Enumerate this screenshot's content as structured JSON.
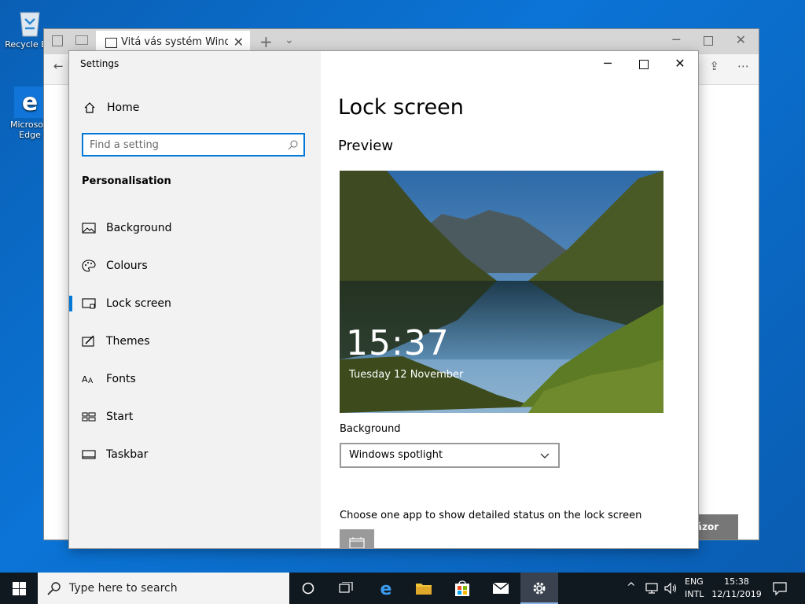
{
  "desktop": {
    "icons": [
      {
        "label": "Recycle Bin"
      },
      {
        "label": "Microsoft Edge"
      }
    ]
  },
  "edge": {
    "tab_title": "Vitá vás systém Windows",
    "feedback_label": "š názor"
  },
  "settings": {
    "app_title": "Settings",
    "home_label": "Home",
    "search_placeholder": "Find a setting",
    "section_title": "Personalisation",
    "nav": [
      {
        "label": "Background",
        "icon": "picture-icon"
      },
      {
        "label": "Colours",
        "icon": "palette-icon"
      },
      {
        "label": "Lock screen",
        "icon": "lock-screen-icon",
        "active": true
      },
      {
        "label": "Themes",
        "icon": "themes-icon"
      },
      {
        "label": "Fonts",
        "icon": "fonts-icon"
      },
      {
        "label": "Start",
        "icon": "start-icon"
      },
      {
        "label": "Taskbar",
        "icon": "taskbar-icon"
      }
    ],
    "page_title": "Lock screen",
    "preview_title": "Preview",
    "lock_time": "15:37",
    "lock_date": "Tuesday 12 November",
    "background_label": "Background",
    "background_value": "Windows spotlight",
    "status_label": "Choose one app to show detailed status on the lock screen",
    "accent_color": "#0078d7"
  },
  "taskbar": {
    "search_placeholder": "Type here to search",
    "lang_top": "ENG",
    "lang_bottom": "INTL",
    "time": "15:38",
    "date": "12/11/2019"
  }
}
